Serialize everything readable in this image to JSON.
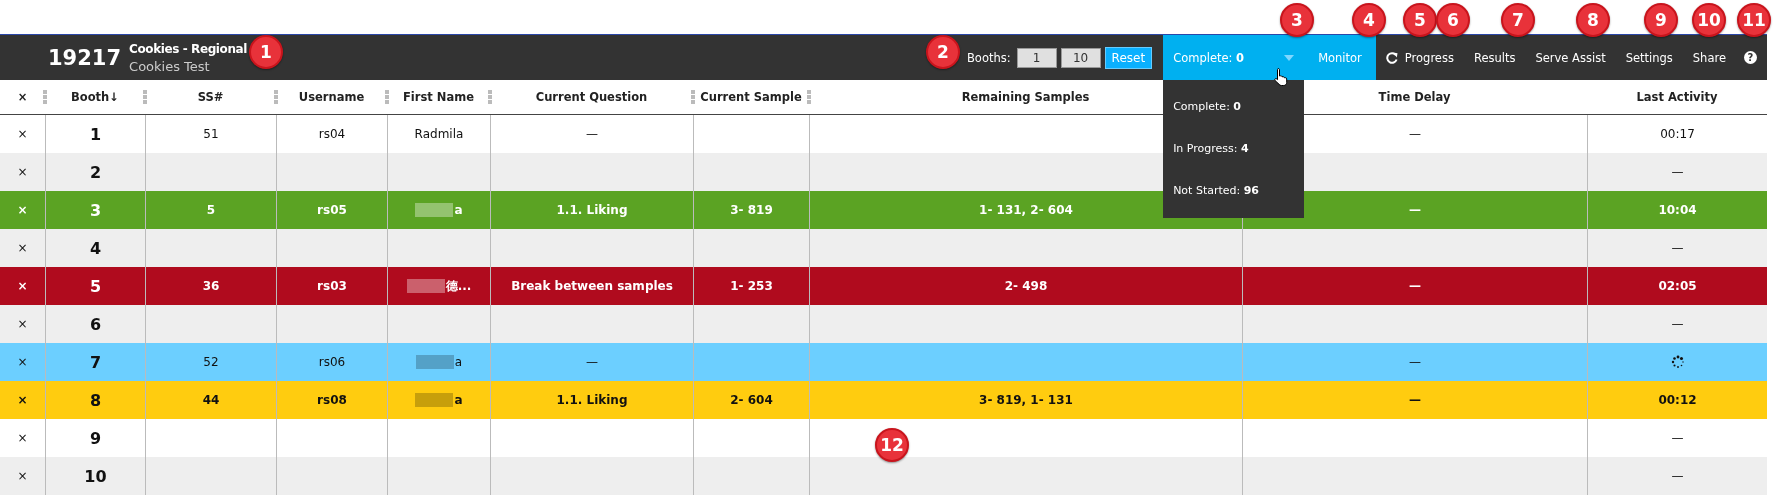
{
  "header": {
    "id": "19217",
    "title": "Cookies - Regional",
    "subtitle": "Cookies Test"
  },
  "toolbar": {
    "booths_label": "Booths:",
    "booth_from": "1",
    "booth_to": "10",
    "reset": "Reset",
    "status_dropdown": {
      "label": "Complete: **0**",
      "expanded": true,
      "options": [
        "Complete: **0**",
        "In Progress: **4**",
        "Not Started: **96**"
      ]
    },
    "tabs": [
      {
        "label": "Monitor",
        "selected": true,
        "kind": "text"
      },
      {
        "label": "Progress",
        "selected": false,
        "kind": "refresh"
      },
      {
        "label": "Results",
        "selected": false,
        "kind": "text"
      },
      {
        "label": "Serve Assist",
        "selected": false,
        "kind": "text"
      },
      {
        "label": "Settings",
        "selected": false,
        "kind": "text"
      },
      {
        "label": "Share",
        "selected": false,
        "kind": "text"
      }
    ],
    "help": "?"
  },
  "table": {
    "columns": [
      "×",
      "Booth↓",
      "SS#",
      "Username",
      "First Name",
      "Current Question",
      "Current Sample",
      "Remaining Samples",
      "Time Delay",
      "Last Activity"
    ],
    "rows": [
      {
        "remove": "×",
        "booth": "1",
        "ss": "51",
        "username": "rs04",
        "first_name": "Radmila",
        "redacted": false,
        "current_question": "—",
        "time_delay": "—",
        "last_activity": "00:17",
        "loading": false,
        "bold": false
      },
      {
        "remove": "×",
        "booth": "2",
        "redacted": false,
        "last_activity": "—",
        "loading": false,
        "bold": false
      },
      {
        "remove": "×",
        "booth": "3",
        "ss": "5",
        "username": "rs05",
        "first_name": "a",
        "redacted": true,
        "current_question": "1.1. Liking",
        "current_sample": "3- 819",
        "remaining_samples": "1- 131, 2- 604",
        "time_delay": "—",
        "last_activity": "10:04",
        "loading": false,
        "bold": true,
        "color": "#5ba323"
      },
      {
        "remove": "×",
        "booth": "4",
        "redacted": false,
        "last_activity": "—",
        "loading": false,
        "bold": false
      },
      {
        "remove": "×",
        "booth": "5",
        "ss": "36",
        "username": "rs03",
        "first_name": "德...",
        "redacted": true,
        "current_question": "Break between samples",
        "current_sample": "1- 253",
        "remaining_samples": "2- 498",
        "time_delay": "—",
        "last_activity": "02:05",
        "loading": false,
        "bold": true,
        "color": "#b00b1e"
      },
      {
        "remove": "×",
        "booth": "6",
        "redacted": false,
        "last_activity": "—",
        "loading": false,
        "bold": false
      },
      {
        "remove": "×",
        "booth": "7",
        "ss": "52",
        "username": "rs06",
        "first_name": "a",
        "redacted": true,
        "current_question": "—",
        "time_delay": "—",
        "loading": true,
        "bold": false,
        "color": "#6ccfff"
      },
      {
        "remove": "×",
        "booth": "8",
        "ss": "44",
        "username": "rs08",
        "first_name": "a",
        "redacted": true,
        "current_question": "1.1. Liking",
        "current_sample": "2- 604",
        "remaining_samples": "3- 819, 1- 131",
        "time_delay": "—",
        "last_activity": "00:12",
        "loading": false,
        "bold": true,
        "color": "#ffcc0f"
      },
      {
        "remove": "×",
        "booth": "9",
        "redacted": false,
        "last_activity": "—",
        "loading": false,
        "bold": false
      },
      {
        "remove": "×",
        "booth": "10",
        "redacted": false,
        "last_activity": "—",
        "loading": false,
        "bold": false
      }
    ]
  },
  "callouts": [
    "1",
    "2",
    "3",
    "4",
    "5",
    "6",
    "7",
    "8",
    "9",
    "10",
    "11",
    "12"
  ]
}
